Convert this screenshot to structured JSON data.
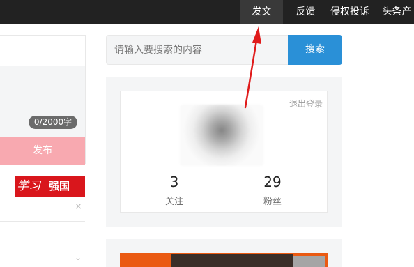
{
  "topbar": {
    "nav_items": [
      {
        "label": "发文",
        "active": true
      },
      {
        "label": "反馈"
      },
      {
        "label": "侵权投诉"
      },
      {
        "label": "头条产"
      }
    ]
  },
  "editor": {
    "char_count": "0/2000字",
    "publish_label": "发布"
  },
  "banner": {
    "logo_text": "学习",
    "text": "强国",
    "close_icon": "×"
  },
  "search": {
    "placeholder": "请输入要搜索的内容",
    "button_label": "搜索"
  },
  "profile": {
    "logout_label": "退出登录",
    "stats": [
      {
        "value": "3",
        "label": "关注"
      },
      {
        "value": "29",
        "label": "粉丝"
      }
    ]
  },
  "colors": {
    "topbar": "#222222",
    "nav_active": "#393939",
    "search_button": "#2a90d7",
    "publish_button": "#f8a9b0",
    "banner_red": "#d9161c",
    "annotation_arrow": "#e01b1b"
  },
  "icons": {
    "banner_close": "close-icon",
    "collapse": "chevron-down-icon",
    "annotation": "red-arrow-pointer"
  }
}
